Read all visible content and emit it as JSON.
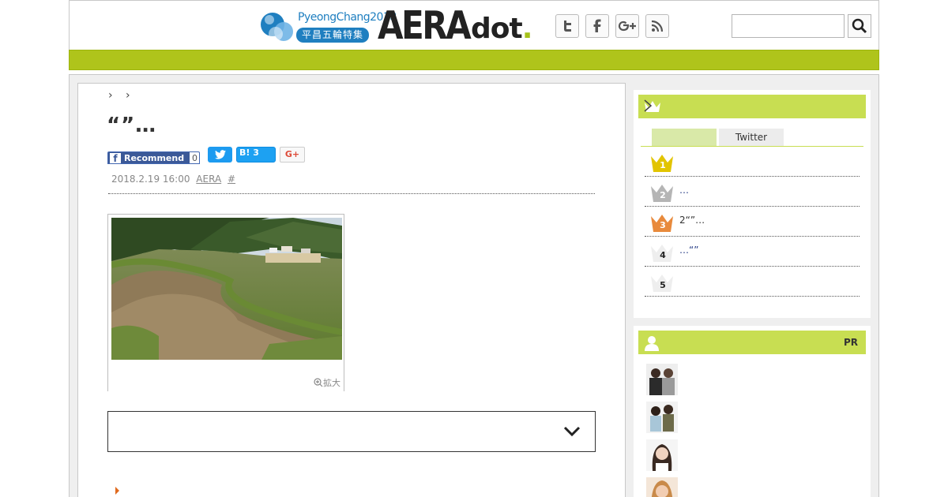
{
  "header": {
    "olympic_title": "PyeongChang2018",
    "olympic_badge": "平昌五輪特集",
    "logo_main": "AERA",
    "logo_sub": "dot",
    "logo_period": ".",
    "search": {
      "placeholder": ""
    },
    "social_icons": [
      "twitter-icon",
      "facebook-icon",
      "google-plus-icon",
      "rss-icon"
    ],
    "accent_color": "#afc41b"
  },
  "article": {
    "breadcrumb": "› ›",
    "headline": "“”…",
    "share": {
      "facebook_label": "Recommend",
      "facebook_count": "0",
      "hatena_label": "B!",
      "hatena_count": "3",
      "googleplus_label": "G+"
    },
    "meta": {
      "date": "2018.2.19 16:00",
      "source": "AERA",
      "tag": "#"
    },
    "photo_enlarge": "拡大",
    "paragraphs": [
      {
        "lines": [
          "",
          ""
        ]
      },
      {
        "lines": [
          ""
        ]
      },
      {
        "lines": [
          "",
          "",
          "",
          ""
        ]
      }
    ]
  },
  "sidebar": {
    "ranking": {
      "tabs": [
        "",
        "Twitter"
      ],
      "rows": [
        {
          "rank": "1",
          "title": ""
        },
        {
          "rank": "2",
          "title": "…"
        },
        {
          "rank": "3",
          "title": "2“”…"
        },
        {
          "rank": "4",
          "title": "…“”"
        },
        {
          "rank": "5",
          "title": ""
        }
      ]
    },
    "pr": {
      "label": "PR"
    }
  }
}
